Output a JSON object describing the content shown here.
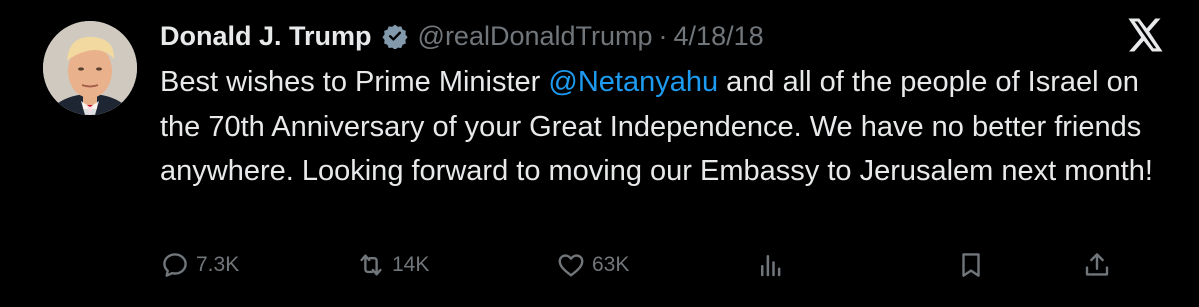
{
  "tweet": {
    "author_name": "Donald J. Trump",
    "handle": "@realDonaldTrump",
    "separator": "·",
    "date": "4/18/18",
    "text_before_mention": "Best wishes to Prime Minister ",
    "mention": "@Netanyahu",
    "text_after_mention": " and all of the people of Israel on the 70th Anniversary of your Great Independence. We have no better friends anywhere. Looking forward to moving our Embassy to Jerusalem next month!",
    "replies": "7.3K",
    "reposts": "14K",
    "likes": "63K"
  },
  "icons": {
    "verified": "verified-badge-icon",
    "platform": "x-logo-icon",
    "reply": "reply-icon",
    "repost": "repost-icon",
    "like": "heart-icon",
    "views": "views-icon",
    "bookmark": "bookmark-icon",
    "share": "share-icon"
  },
  "colors": {
    "background": "#000000",
    "text": "#e7e9ea",
    "secondary": "#71767b",
    "link": "#1d9bf0"
  }
}
